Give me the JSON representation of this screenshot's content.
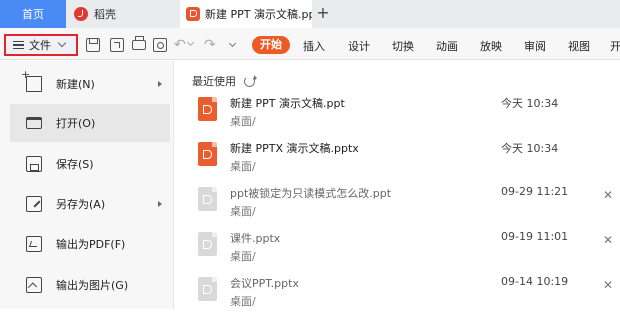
{
  "tabs": {
    "home": "首页",
    "daoke": "稻壳",
    "doc": "新建 PPT 演示文稿.pp",
    "plus": "+"
  },
  "toolbar": {
    "file_label": "文件",
    "start_label": "开始",
    "menu_tabs": [
      "插入",
      "设计",
      "切换",
      "动画",
      "放映",
      "审阅",
      "视图",
      "开"
    ],
    "undo_glyph": "↶",
    "redo_glyph": "↷"
  },
  "file_menu": {
    "items": [
      {
        "label": "新建(N)",
        "icon": "new-file-icon",
        "has_submenu": true
      },
      {
        "label": "打开(O)",
        "icon": "open-folder-icon",
        "has_submenu": false,
        "active": true
      },
      {
        "label": "保存(S)",
        "icon": "save-icon",
        "has_submenu": false
      },
      {
        "label": "另存为(A)",
        "icon": "save-as-icon",
        "has_submenu": true
      },
      {
        "label": "输出为PDF(F)",
        "icon": "export-pdf-icon",
        "has_submenu": false
      },
      {
        "label": "输出为图片(G)",
        "icon": "export-image-icon",
        "has_submenu": false
      }
    ]
  },
  "recent": {
    "header": "最近使用",
    "files": [
      {
        "name": "新建 PPT 演示文稿.ppt",
        "path": "桌面/",
        "time": "今天  10:34",
        "icon_color": "orange",
        "closable": false
      },
      {
        "name": "新建 PPTX 演示文稿.pptx",
        "path": "桌面/",
        "time": "今天  10:34",
        "icon_color": "orange",
        "closable": false
      },
      {
        "name": "ppt被锁定为只读模式怎么改.ppt",
        "path": "桌面/",
        "time": "09-29  11:21",
        "icon_color": "grey",
        "closable": true
      },
      {
        "name": "课件.pptx",
        "path": "桌面/",
        "time": "09-19  11:01",
        "icon_color": "grey",
        "closable": true
      },
      {
        "name": "会议PPT.pptx",
        "path": "桌面/",
        "time": "09-14  10:19",
        "icon_color": "grey",
        "closable": true
      }
    ],
    "close_glyph": "✕"
  },
  "colors": {
    "home_tab": "#4a8af4",
    "start_button": "#ee5a24",
    "file_highlight_border": "#e0262a",
    "ppt_orange": "#ea5d2f"
  }
}
